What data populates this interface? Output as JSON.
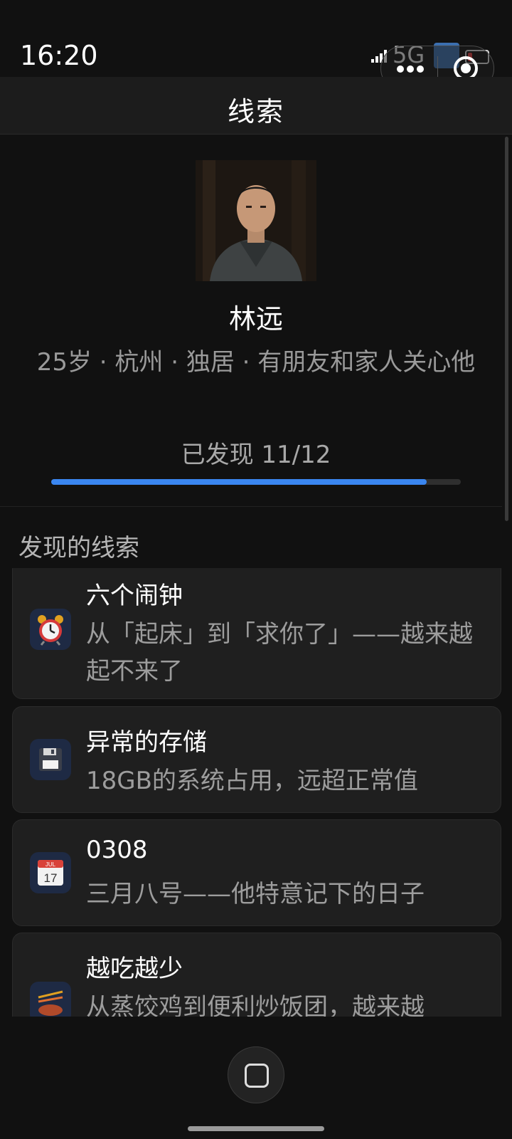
{
  "status": {
    "time": "16:20",
    "network": "5G"
  },
  "header": {
    "title": "线索"
  },
  "profile": {
    "name": "林远",
    "description": "25岁 · 杭州 · 独居 · 有朋友和家人关心他",
    "progress_label": "已发现 11/12",
    "progress": {
      "found": 11,
      "total": 12
    }
  },
  "clues": {
    "section_title": "发现的线索",
    "items": [
      {
        "icon": "alarm-clock-icon",
        "title": "六个闹钟",
        "desc": "从「起床」到「求你了」——越来越起不来了"
      },
      {
        "icon": "floppy-disk-icon",
        "title": "异常的存储",
        "desc": "18GB的系统占用，远超正常值"
      },
      {
        "icon": "calendar-icon",
        "title": "0308",
        "desc": "三月八号——他特意记下的日子",
        "calendar_month": "JUL",
        "calendar_day": "17"
      },
      {
        "icon": "food-icon",
        "title": "越吃越少",
        "desc": "从蒸饺鸡到便利炒饭团，越来越"
      }
    ]
  },
  "colors": {
    "accent": "#3a86f0",
    "background": "#111111",
    "card": "#1f1f1f"
  }
}
